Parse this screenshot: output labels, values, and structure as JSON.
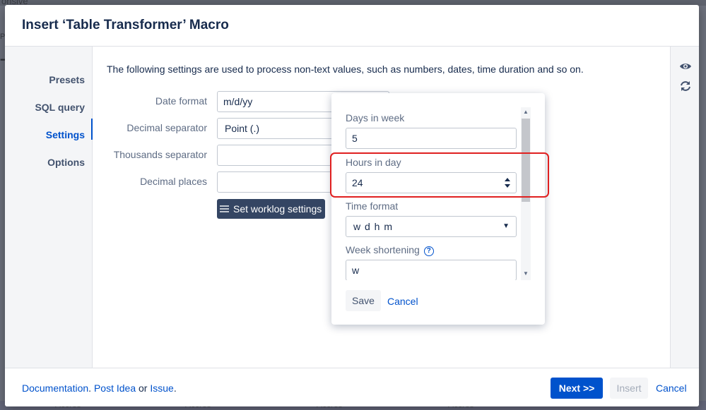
{
  "background": {
    "frag_top_left": "onsive",
    "frag_pe": "Pe",
    "frag_big": "T",
    "bottom_cells": [
      "Accres",
      "Accres",
      "Accres",
      "Accres"
    ]
  },
  "dialog": {
    "title": "Insert ‘Table Transformer’ Macro"
  },
  "nav": {
    "items": [
      {
        "label": "Presets",
        "active": false
      },
      {
        "label": "SQL query",
        "active": false
      },
      {
        "label": "Settings",
        "active": true
      },
      {
        "label": "Options",
        "active": false
      }
    ]
  },
  "rightbar": {
    "icons": [
      "eye-icon",
      "refresh-icon"
    ]
  },
  "settings": {
    "intro": "The following settings are used to process non-text values, such as numbers, dates, time duration and so on.",
    "date_format": {
      "label": "Date format",
      "value": "m/d/yy"
    },
    "decimal_separator": {
      "label": "Decimal separator",
      "value": "Point (.)"
    },
    "thousands_separator": {
      "label": "Thousands separator",
      "value": ""
    },
    "decimal_places": {
      "label": "Decimal places",
      "value": ""
    },
    "worklog_button": "Set worklog settings"
  },
  "worklog_popup": {
    "days_in_week": {
      "label": "Days in week",
      "value": "5"
    },
    "hours_in_day": {
      "label": "Hours in day",
      "value": "24"
    },
    "time_format": {
      "label": "Time format",
      "value": "w d h m"
    },
    "week_shortening": {
      "label": "Week shortening",
      "value": "w"
    },
    "help_glyph": "?",
    "save_label": "Save",
    "cancel_label": "Cancel"
  },
  "footer": {
    "documentation": "Documentation",
    "separator": ".",
    "post_idea": "Post Idea",
    "or": "or",
    "issue": "Issue",
    "period": ".",
    "next_label": "Next >>",
    "insert_label": "Insert",
    "cancel_label": "Cancel"
  },
  "colors": {
    "primary": "#0052cc",
    "dark_button": "#344563",
    "highlight": "#e02020"
  }
}
